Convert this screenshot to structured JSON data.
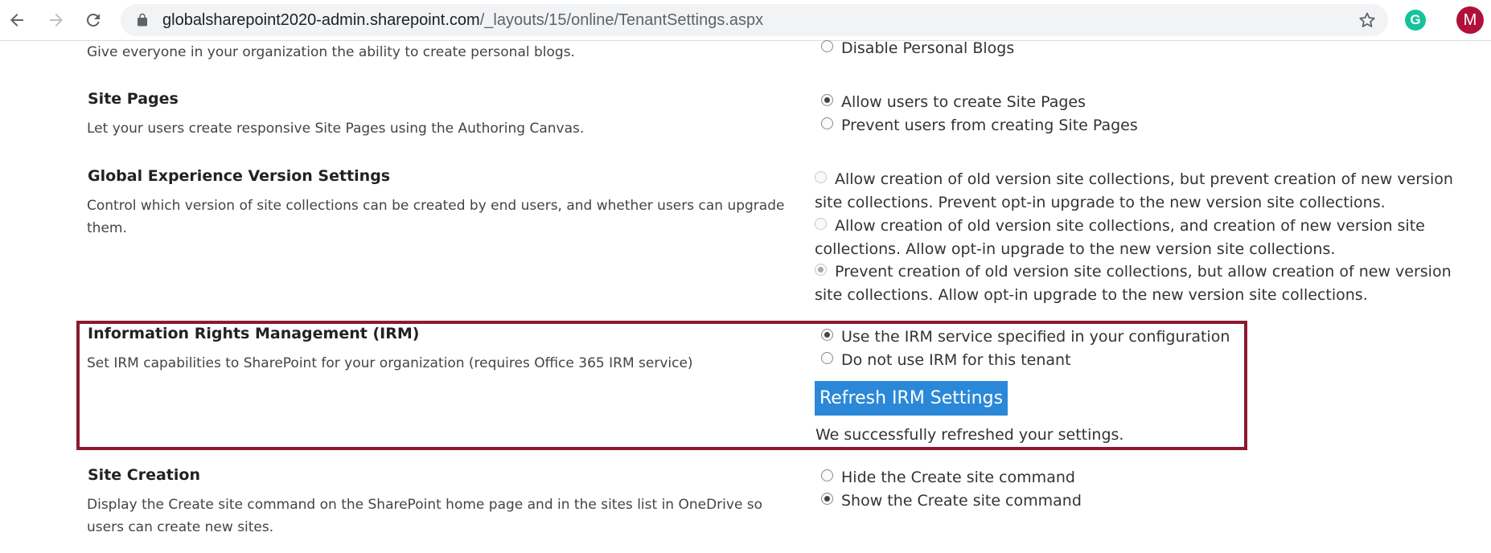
{
  "browser": {
    "url_domain": "globalsharepoint2020-admin.sharepoint.com",
    "url_path": "/_layouts/15/online/TenantSettings.aspx",
    "extension_letter": "G",
    "profile_initial": "M"
  },
  "personal_blogs": {
    "description": "Give everyone in your organization the ability to create personal blogs.",
    "options": [
      "Disable Personal Blogs"
    ]
  },
  "site_pages": {
    "title": "Site Pages",
    "description": "Let your users create responsive Site Pages using the Authoring Canvas.",
    "options": [
      "Allow users to create Site Pages",
      "Prevent users from creating Site Pages"
    ],
    "selected": 0
  },
  "global_experience": {
    "title": "Global Experience Version Settings",
    "description": "Control which version of site collections can be created by end users, and whether users can upgrade them.",
    "options": [
      "Allow creation of old version site collections, but prevent creation of new version site collections. Prevent opt-in upgrade to the new version site collections.",
      "Allow creation of old version site collections, and creation of new version site collections. Allow opt-in upgrade to the new version site collections.",
      "Prevent creation of old version site collections, but allow creation of new version site collections. Allow opt-in upgrade to the new version site collections."
    ],
    "selected": 2
  },
  "irm": {
    "title": "Information Rights Management (IRM)",
    "description": "Set IRM capabilities to SharePoint for your organization (requires Office 365 IRM service)",
    "options": [
      "Use the IRM service specified in your configuration",
      "Do not use IRM for this tenant"
    ],
    "selected": 0,
    "refresh_button": "Refresh IRM Settings",
    "status_message": "We successfully refreshed your settings.",
    "highlight_color": "#8b1a2e",
    "button_color": "#2b88d8"
  },
  "site_creation": {
    "title": "Site Creation",
    "description": "Display the Create site command on the SharePoint home page and in the sites list in OneDrive so users can create new sites.",
    "options": [
      "Hide the Create site command",
      "Show the Create site command"
    ],
    "selected": 1
  }
}
